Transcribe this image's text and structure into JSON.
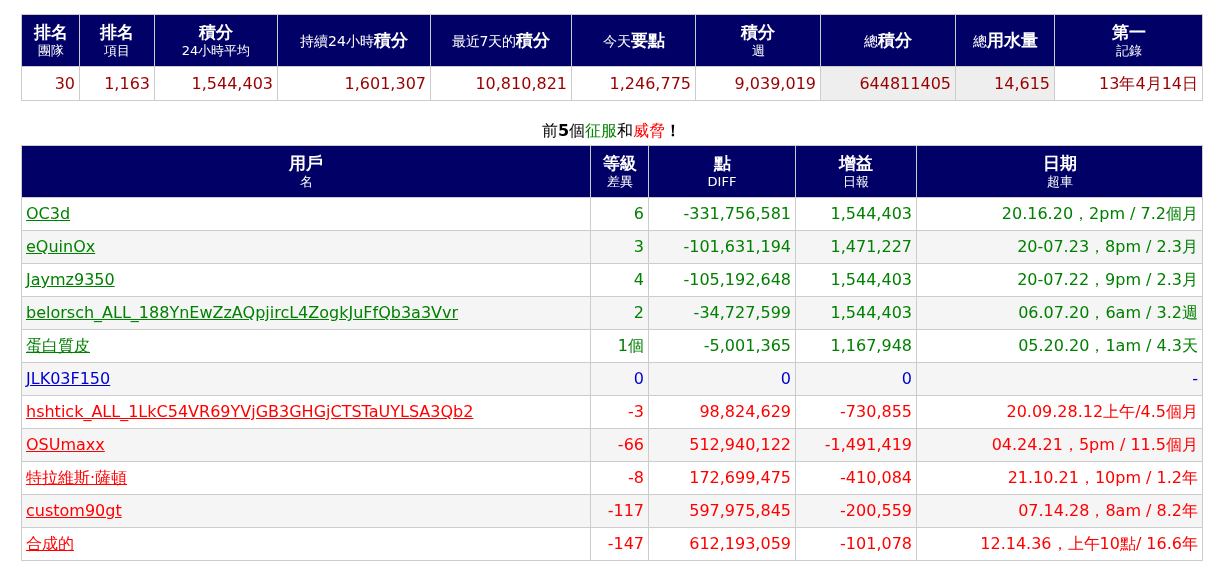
{
  "summary": {
    "columns": [
      {
        "title": "排名",
        "sub": "團隊"
      },
      {
        "title": "排名",
        "sub": "項目"
      },
      {
        "title": "積分",
        "sub": "24小時平均"
      },
      {
        "title": "持續24小時**積分**"
      },
      {
        "title": "最近7天的**積分**"
      },
      {
        "title": "今天**要點**"
      },
      {
        "title": "積分",
        "sub": "週"
      },
      {
        "title": "總**積分**"
      },
      {
        "title": "總**用水量**"
      },
      {
        "title": "第一",
        "sub": "記錄"
      }
    ],
    "values": [
      {
        "text": "30",
        "shaded": false
      },
      {
        "text": "1,163",
        "shaded": false
      },
      {
        "text": "1,544,403",
        "shaded": false
      },
      {
        "text": "1,601,307",
        "shaded": false
      },
      {
        "text": "10,810,821",
        "shaded": false
      },
      {
        "text": "1,246,775",
        "shaded": false
      },
      {
        "text": "9,039,019",
        "shaded": false
      },
      {
        "text": "644811405",
        "shaded": true
      },
      {
        "text": "14,615",
        "shaded": true
      },
      {
        "text": "13年4月14日",
        "shaded": false
      }
    ]
  },
  "rivals": {
    "title_parts": [
      {
        "text": "前**5**個",
        "color": "#000000"
      },
      {
        "text": "征服",
        "color": "#008000"
      },
      {
        "text": "和",
        "color": "#000000"
      },
      {
        "text": "威脅",
        "color": "#ff0000"
      },
      {
        "text": "**！**",
        "color": "#000000"
      }
    ],
    "columns": [
      {
        "title": "用戶",
        "sub": "名"
      },
      {
        "title": "等級",
        "sub": "差異"
      },
      {
        "title": "點",
        "sub": "DIFF"
      },
      {
        "title": "增益",
        "sub": "日報"
      },
      {
        "title": "日期",
        "sub": "超車"
      }
    ],
    "rows": [
      {
        "color": "#008000",
        "cells": [
          "OC3d",
          "6",
          "-331,756,581",
          "1,544,403",
          "20.16.20，2pm / 7.2個月"
        ]
      },
      {
        "color": "#008000",
        "cells": [
          "eQuinOx",
          "3",
          "-101,631,194",
          "1,471,227",
          "20-07.23，8pm / 2.3月"
        ]
      },
      {
        "color": "#008000",
        "cells": [
          "Jaymz9350",
          "4",
          "-105,192,648",
          "1,544,403",
          "20-07.22，9pm / 2.3月"
        ]
      },
      {
        "color": "#008000",
        "cells": [
          "belorsch_ALL_188YnEwZzAQpjircL4ZogkJuFfQb3a3Vvr",
          "2",
          "-34,727,599",
          "1,544,403",
          "06.07.20，6am / 3.2週"
        ]
      },
      {
        "color": "#008000",
        "cells": [
          "蛋白質皮",
          "1個",
          "-5,001,365",
          "1,167,948",
          "05.20.20，1am / 4.3天"
        ]
      },
      {
        "color": "#0000cc",
        "cells": [
          "JLK03F150",
          "0",
          "0",
          "0",
          "-"
        ]
      },
      {
        "color": "#ff0000",
        "cells": [
          "hshtick_ALL_1LkC54VR69YVjGB3GHGjCTSTaUYLSA3Qb2",
          "-3",
          "98,824,629",
          "-730,855",
          "20.09.28.12上午/4.5個月"
        ]
      },
      {
        "color": "#ff0000",
        "cells": [
          "OSUmaxx",
          "-66",
          "512,940,122",
          "-1,491,419",
          "04.24.21，5pm / 11.5個月"
        ]
      },
      {
        "color": "#ff0000",
        "cells": [
          "特拉維斯·薩頓",
          "-8",
          "172,699,475",
          "-410,084",
          "21.10.21，10pm / 1.2年"
        ]
      },
      {
        "color": "#ff0000",
        "cells": [
          "custom90gt",
          "-117",
          "597,975,845",
          "-200,559",
          "07.14.28，8am / 8.2年"
        ]
      },
      {
        "color": "#ff0000",
        "cells": [
          "合成的",
          "-147",
          "612,193,059",
          "-101,078",
          "12.14.36，上午10點/ 16.6年"
        ]
      }
    ]
  }
}
